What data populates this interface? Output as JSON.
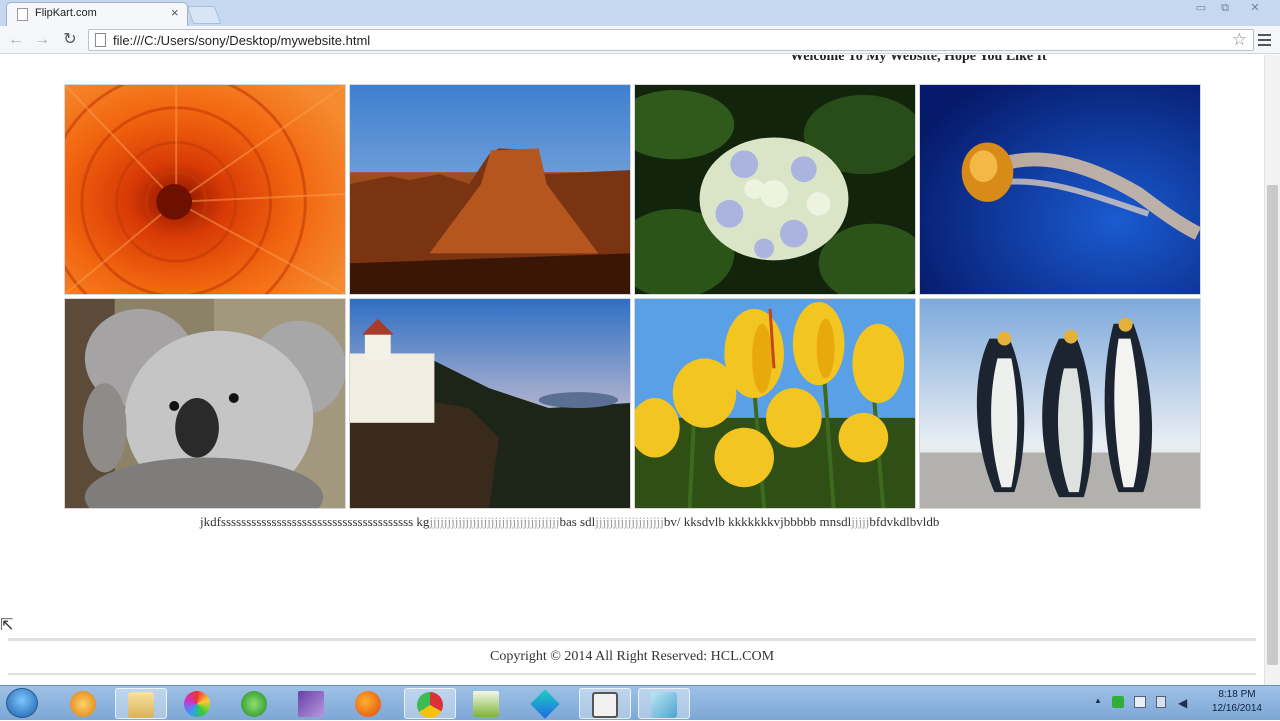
{
  "browser": {
    "tab_title": "FlipKart.com",
    "tab_close": "×",
    "url": "file:///C:/Users/sony/Desktop/mywebsite.html",
    "back": "←",
    "forward": "→",
    "reload": "↻",
    "star": "☆",
    "window_minimize": "▭",
    "window_restore": "⧉",
    "window_close": "✕"
  },
  "page": {
    "welcome": "Welcome To My Website, Hope You Like It",
    "gallery": [
      {
        "subject": "chrysanthemum"
      },
      {
        "subject": "desert"
      },
      {
        "subject": "hydrangeas"
      },
      {
        "subject": "jellyfish"
      },
      {
        "subject": "koala"
      },
      {
        "subject": "lighthouse"
      },
      {
        "subject": "tulips"
      },
      {
        "subject": "penguins"
      }
    ],
    "line_part1": "jkdfssssssssssssssssssssssssssssssssssssss kg",
    "line_link1": "jjjjjjjjjjjjjjjjjjjjjjjjjjjjjjjjjjjj",
    "line_part2": "bas sdl",
    "line_link2": "jjjjjjjjjjjjjjjjjjj",
    "line_part3": "bv/ kksdvlb kkkkkkkvjbbbbb mnsdl",
    "line_link3": "jjjjj",
    "line_part4": "bfdvkdlbvldb",
    "copyright": "Copyright © 2014 All Right Reserved: HCL.COM"
  },
  "taskbar": {
    "clock_time": "8:18 PM",
    "clock_date": "12/16/2014",
    "tray_arrow": "▲"
  }
}
